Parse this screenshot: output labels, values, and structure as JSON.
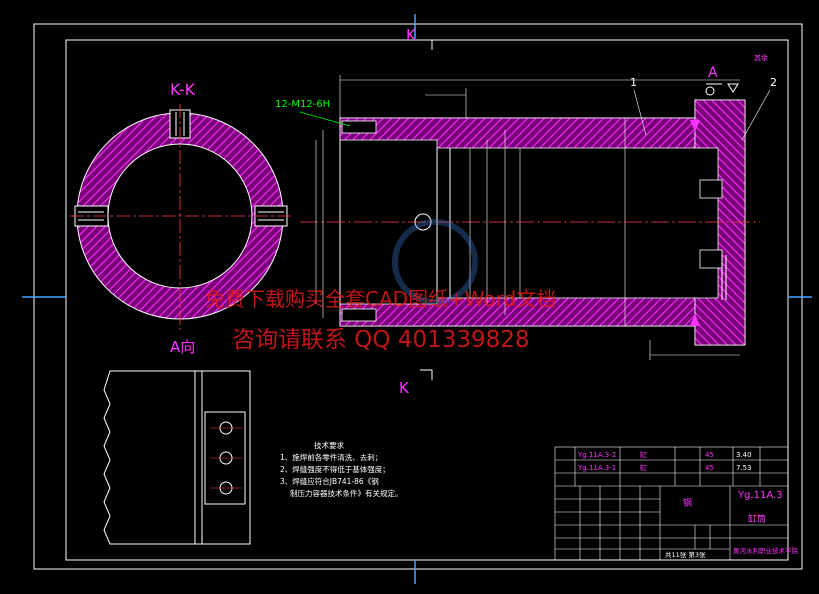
{
  "drawing": {
    "section_label": "K-K",
    "view_label": "A向",
    "cut_mark_top": "K",
    "cut_mark_bottom": "K",
    "thread_callout": "12-M12-6H",
    "view_arrow_label": "A",
    "part_balloon_1": "1",
    "part_balloon_2": "2",
    "roughness_label": "其余"
  },
  "tech_notes": {
    "title": "技术要求",
    "line1": "1、施焊前各零件清洗、去刺；",
    "line2": "2、焊缝强度不得低于基体强度；",
    "line3": "3、焊缝应符合JB741-86《钢",
    "line4": "制压力容器技术条件》有关规定。"
  },
  "title_block": {
    "drawing_no": "Yg.11A.3",
    "part_name": "缸筒",
    "material": "钢",
    "company": "黄河水利职业技术学院",
    "sheet_info": "共11张 第3张",
    "row1_code": "Yg.11A.3-2",
    "row2_code": "Yg.11A.3-1",
    "row1_name": "缸",
    "row2_name": "缸",
    "row1_mat": "45",
    "row2_mat": "45",
    "weight_a": "3.40",
    "weight_b": "7.53"
  },
  "watermark": {
    "line1": "免费下载购买全套CAD图纸+Word文档",
    "line2": "咨询请联系 QQ 401339828"
  },
  "colors": {
    "outline": "#ffffff",
    "hatch": "#ff00ff",
    "dimension": "#ffffff",
    "callout": "#00ff00",
    "watermark": "#e21a1a",
    "cut_mark": "#ff00ff"
  }
}
